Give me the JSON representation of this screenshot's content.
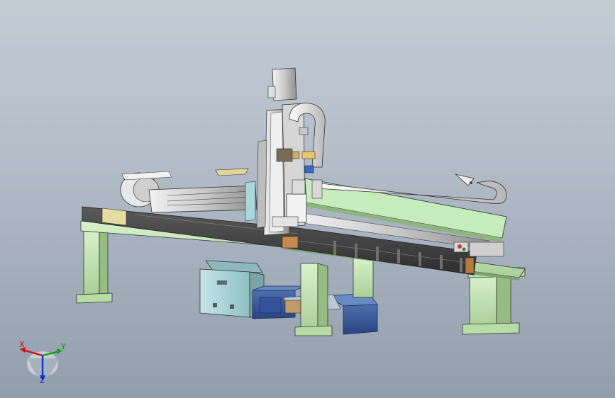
{
  "viewport": {
    "background_top": "#c3cbd5",
    "background_bottom": "#929eac"
  },
  "colors": {
    "frame_green": "#c8eaba",
    "frame_green_dark": "#8fb57e",
    "rail_dark": "#3d3d3d",
    "steel_light": "#dcdcdc",
    "steel_mid": "#a9a9a9",
    "panel_teal": "#a6d0d2",
    "motor_blue": "#3a5a9a",
    "motor_blue_dark": "#2a4580",
    "accent_orange": "#b07a3a",
    "accent_yellow": "#e5d79a",
    "accent_red": "#c43c2c"
  },
  "triad": {
    "x_label": "X",
    "y_label": "Y",
    "z_label": "Z",
    "x_color": "#d01010",
    "y_color": "#10a010",
    "z_color": "#1030d0",
    "icon": "coordinate-triad-icon"
  },
  "model": {
    "icon": "gantry-robot-cad-model"
  }
}
